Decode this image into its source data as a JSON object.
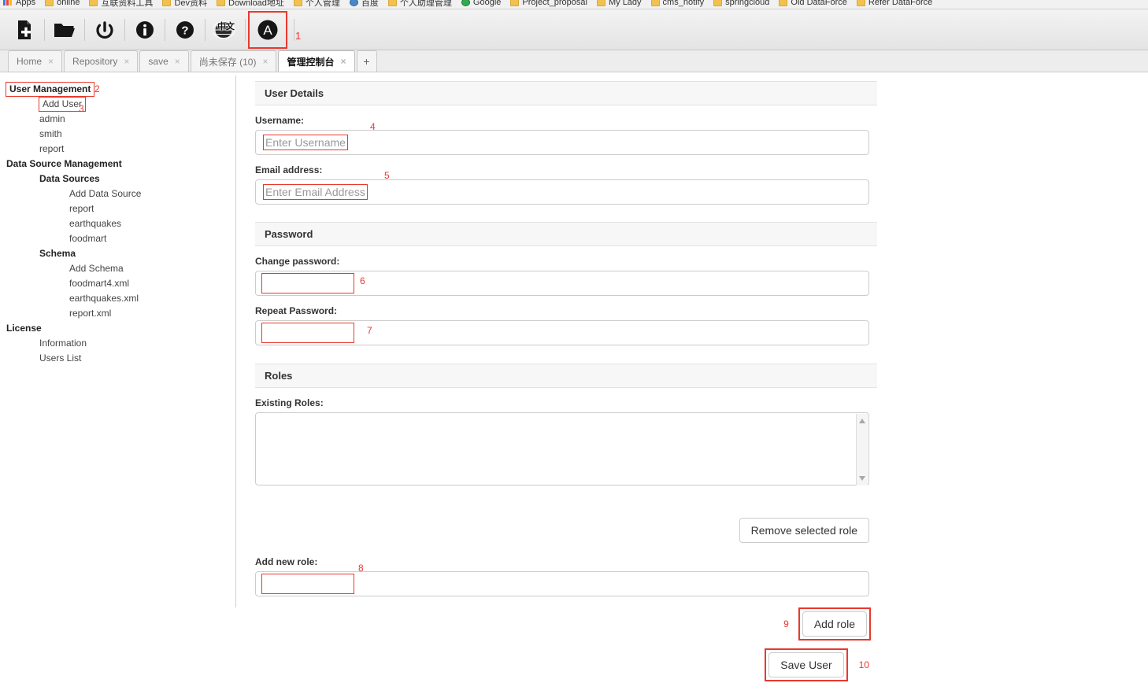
{
  "browser": {
    "bookmarks": [
      {
        "label": "Apps",
        "icon": "apps-icon"
      },
      {
        "label": "online",
        "icon": "folder-icon"
      },
      {
        "label": "互联资料工具",
        "icon": "folder-icon"
      },
      {
        "label": "Dev资料",
        "icon": "folder-icon"
      },
      {
        "label": "Download地址",
        "icon": "folder-icon"
      },
      {
        "label": "个人管理",
        "icon": "folder-icon"
      },
      {
        "label": "百度",
        "icon": "globe-icon"
      },
      {
        "label": "个人助理管理",
        "icon": "folder-icon"
      },
      {
        "label": "Google",
        "icon": "green-circle-icon"
      },
      {
        "label": "Project_proposal",
        "icon": "folder-icon"
      },
      {
        "label": "My Lady",
        "icon": "folder-icon"
      },
      {
        "label": "cms_notify",
        "icon": "folder-icon"
      },
      {
        "label": "springcloud",
        "icon": "folder-icon"
      },
      {
        "label": "Old DataForce",
        "icon": "folder-icon"
      },
      {
        "label": "Refer DataForce",
        "icon": "folder-icon"
      }
    ]
  },
  "toolbar": {
    "buttons": [
      {
        "name": "new-document-icon",
        "title": "New"
      },
      {
        "name": "open-folder-icon",
        "title": "Open"
      },
      {
        "name": "power-icon",
        "title": "Logout"
      },
      {
        "name": "info-icon",
        "title": "Info"
      },
      {
        "name": "help-icon",
        "title": "Help"
      },
      {
        "name": "language-globe-icon",
        "title": "中文"
      },
      {
        "name": "admin-console-icon",
        "title": "Administration"
      }
    ],
    "language_overlay": "中文",
    "admin_glyph": "A",
    "selected_index": 6,
    "annotation": "1",
    "highlight_color": "#e8392e"
  },
  "tabs": {
    "items": [
      {
        "label": "Home",
        "active": false
      },
      {
        "label": "Repository",
        "active": false
      },
      {
        "label": "save",
        "active": false
      },
      {
        "label": "尚未保存 (10)",
        "active": false
      },
      {
        "label": "管理控制台",
        "active": true
      }
    ],
    "close_glyph": "×",
    "add_label": "+"
  },
  "sidebar": {
    "items": [
      {
        "label": "User Management",
        "level": 0,
        "bold": true,
        "boxed": true,
        "annotation": "2"
      },
      {
        "label": "Add User",
        "level": 1,
        "bold": false,
        "boxed": true,
        "annotation": "3"
      },
      {
        "label": "admin",
        "level": 1,
        "bold": false,
        "boxed": false,
        "annotation": ""
      },
      {
        "label": "smith",
        "level": 1,
        "bold": false,
        "boxed": false,
        "annotation": ""
      },
      {
        "label": "report",
        "level": 1,
        "bold": false,
        "boxed": false,
        "annotation": ""
      },
      {
        "label": "Data Source Management",
        "level": 0,
        "bold": true,
        "boxed": false,
        "annotation": ""
      },
      {
        "label": "Data Sources",
        "level": 1,
        "bold": true,
        "boxed": false,
        "annotation": ""
      },
      {
        "label": "Add Data Source",
        "level": 2,
        "bold": false,
        "boxed": false,
        "annotation": ""
      },
      {
        "label": "report",
        "level": 2,
        "bold": false,
        "boxed": false,
        "annotation": ""
      },
      {
        "label": "earthquakes",
        "level": 2,
        "bold": false,
        "boxed": false,
        "annotation": ""
      },
      {
        "label": "foodmart",
        "level": 2,
        "bold": false,
        "boxed": false,
        "annotation": ""
      },
      {
        "label": "Schema",
        "level": 1,
        "bold": true,
        "boxed": false,
        "annotation": ""
      },
      {
        "label": "Add Schema",
        "level": 2,
        "bold": false,
        "boxed": false,
        "annotation": ""
      },
      {
        "label": "foodmart4.xml",
        "level": 2,
        "bold": false,
        "boxed": false,
        "annotation": ""
      },
      {
        "label": "earthquakes.xml",
        "level": 2,
        "bold": false,
        "boxed": false,
        "annotation": ""
      },
      {
        "label": "report.xml",
        "level": 2,
        "bold": false,
        "boxed": false,
        "annotation": ""
      },
      {
        "label": "License",
        "level": 0,
        "bold": true,
        "boxed": false,
        "annotation": ""
      },
      {
        "label": "Information",
        "level": 1,
        "bold": false,
        "boxed": false,
        "annotation": ""
      },
      {
        "label": "Users List",
        "level": 1,
        "bold": false,
        "boxed": false,
        "annotation": ""
      }
    ]
  },
  "form": {
    "user_details": {
      "section_title": "User Details",
      "username_label": "Username:",
      "username_value": "",
      "username_placeholder": "Enter Username",
      "username_annotation": "4",
      "email_label": "Email address:",
      "email_value": "",
      "email_placeholder": "Enter Email Address",
      "email_annotation": "5"
    },
    "password": {
      "section_title": "Password",
      "change_label": "Change password:",
      "change_value": "",
      "change_annotation": "6",
      "repeat_label": "Repeat Password:",
      "repeat_value": "",
      "repeat_annotation": "7"
    },
    "roles": {
      "section_title": "Roles",
      "existing_label": "Existing Roles:",
      "existing_options": [],
      "remove_button": "Remove selected role",
      "add_new_label": "Add new role:",
      "add_new_value": "",
      "add_new_annotation": "8",
      "add_role_button": "Add role",
      "add_role_annotation": "9"
    },
    "save_button": "Save User",
    "save_annotation": "10"
  }
}
